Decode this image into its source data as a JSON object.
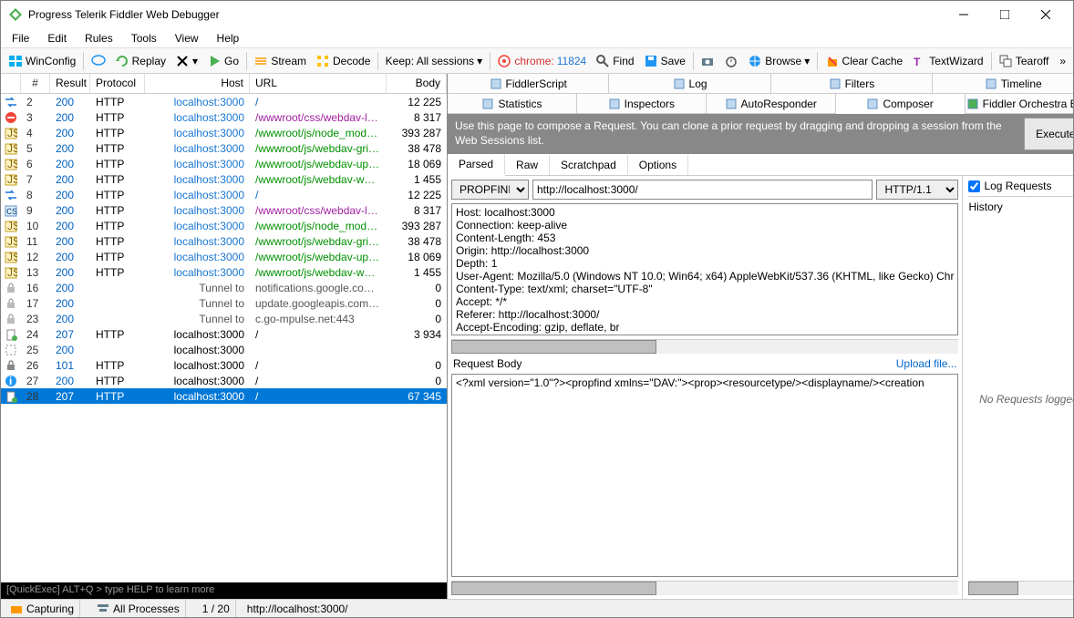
{
  "title": "Progress Telerik Fiddler Web Debugger",
  "menu": [
    "File",
    "Edit",
    "Rules",
    "Tools",
    "View",
    "Help"
  ],
  "toolbar": {
    "winconfig": "WinConfig",
    "replay": "Replay",
    "go": "Go",
    "stream": "Stream",
    "decode": "Decode",
    "keep": "Keep: All sessions",
    "chrome": "chrome:",
    "chrome_pid": "11824",
    "find": "Find",
    "save": "Save",
    "browse": "Browse",
    "clearcache": "Clear Cache",
    "textwizard": "TextWizard",
    "tearoff": "Tearoff"
  },
  "grid": {
    "headers": [
      "#",
      "Result",
      "Protocol",
      "Host",
      "URL",
      "Body"
    ],
    "rows": [
      {
        "ico": "arrows",
        "n": "2",
        "res": "200",
        "proto": "HTTP",
        "host": "localhost:3000",
        "hostc": "host-local",
        "url": "/",
        "urlc": "url-blue",
        "body": "12 225"
      },
      {
        "ico": "stop",
        "n": "3",
        "res": "200",
        "proto": "HTTP",
        "host": "localhost:3000",
        "hostc": "host-local",
        "url": "/wwwroot/css/webdav-la...",
        "urlc": "url-purple",
        "body": "8 317"
      },
      {
        "ico": "js",
        "n": "4",
        "res": "200",
        "proto": "HTTP",
        "host": "localhost:3000",
        "hostc": "host-local",
        "url": "/wwwroot/js/node_modul...",
        "urlc": "url-green",
        "body": "393 287"
      },
      {
        "ico": "js",
        "n": "5",
        "res": "200",
        "proto": "HTTP",
        "host": "localhost:3000",
        "hostc": "host-local",
        "url": "/wwwroot/js/webdav-grid...",
        "urlc": "url-green",
        "body": "38 478"
      },
      {
        "ico": "js",
        "n": "6",
        "res": "200",
        "proto": "HTTP",
        "host": "localhost:3000",
        "hostc": "host-local",
        "url": "/wwwroot/js/webdav-uplo...",
        "urlc": "url-green",
        "body": "18 069"
      },
      {
        "ico": "js",
        "n": "7",
        "res": "200",
        "proto": "HTTP",
        "host": "localhost:3000",
        "hostc": "host-local",
        "url": "/wwwroot/js/webdav-web...",
        "urlc": "url-green",
        "body": "1 455"
      },
      {
        "ico": "arrows",
        "n": "8",
        "res": "200",
        "proto": "HTTP",
        "host": "localhost:3000",
        "hostc": "host-local",
        "url": "/",
        "urlc": "url-blue",
        "body": "12 225"
      },
      {
        "ico": "css",
        "n": "9",
        "res": "200",
        "proto": "HTTP",
        "host": "localhost:3000",
        "hostc": "host-local",
        "url": "/wwwroot/css/webdav-la...",
        "urlc": "url-purple",
        "body": "8 317"
      },
      {
        "ico": "js",
        "n": "10",
        "res": "200",
        "proto": "HTTP",
        "host": "localhost:3000",
        "hostc": "host-local",
        "url": "/wwwroot/js/node_modul...",
        "urlc": "url-green",
        "body": "393 287"
      },
      {
        "ico": "js",
        "n": "11",
        "res": "200",
        "proto": "HTTP",
        "host": "localhost:3000",
        "hostc": "host-local",
        "url": "/wwwroot/js/webdav-grid...",
        "urlc": "url-green",
        "body": "38 478"
      },
      {
        "ico": "js",
        "n": "12",
        "res": "200",
        "proto": "HTTP",
        "host": "localhost:3000",
        "hostc": "host-local",
        "url": "/wwwroot/js/webdav-uplo...",
        "urlc": "url-green",
        "body": "18 069"
      },
      {
        "ico": "js",
        "n": "13",
        "res": "200",
        "proto": "HTTP",
        "host": "localhost:3000",
        "hostc": "host-local",
        "url": "/wwwroot/js/webdav-web...",
        "urlc": "url-green",
        "body": "1 455"
      },
      {
        "ico": "lock",
        "n": "16",
        "res": "200",
        "proto": "",
        "host": "Tunnel to",
        "hostc": "host-tunnel",
        "url": "notifications.google.com:...",
        "urlc": "url-gray",
        "body": "0"
      },
      {
        "ico": "lock",
        "n": "17",
        "res": "200",
        "proto": "",
        "host": "Tunnel to",
        "hostc": "host-tunnel",
        "url": "update.googleapis.com:443",
        "urlc": "url-gray",
        "body": "0"
      },
      {
        "ico": "lock",
        "n": "23",
        "res": "200",
        "proto": "",
        "host": "Tunnel to",
        "hostc": "host-tunnel",
        "url": "c.go-mpulse.net:443",
        "urlc": "url-gray",
        "body": "0"
      },
      {
        "ico": "doc",
        "n": "24",
        "res": "207",
        "proto": "HTTP",
        "host": "localhost:3000",
        "hostc": "",
        "url": "/",
        "urlc": "",
        "body": "3 934"
      },
      {
        "ico": "nc",
        "n": "25",
        "res": "200",
        "proto": "",
        "host": "localhost:3000",
        "hostc": "",
        "url": "",
        "urlc": "",
        "body": ""
      },
      {
        "ico": "lock2",
        "n": "26",
        "res": "101",
        "proto": "HTTP",
        "host": "localhost:3000",
        "hostc": "",
        "url": "/",
        "urlc": "",
        "body": "0"
      },
      {
        "ico": "info",
        "n": "27",
        "res": "200",
        "proto": "HTTP",
        "host": "localhost:3000",
        "hostc": "",
        "url": "/",
        "urlc": "",
        "body": "0"
      },
      {
        "ico": "doc",
        "n": "28",
        "res": "207",
        "proto": "HTTP",
        "host": "localhost:3000",
        "hostc": "",
        "url": "/",
        "urlc": "",
        "body": "67 345",
        "sel": true
      }
    ]
  },
  "quickexec": "[QuickExec] ALT+Q > type HELP to learn more",
  "status": {
    "capturing": "Capturing",
    "allproc": "All Processes",
    "count": "1 / 20",
    "url": "http://localhost:3000/"
  },
  "rtabs_top": [
    {
      "icon": "script",
      "label": "FiddlerScript"
    },
    {
      "icon": "log",
      "label": "Log"
    },
    {
      "icon": "filter",
      "label": "Filters"
    },
    {
      "icon": "timeline",
      "label": "Timeline"
    }
  ],
  "rtabs_bot": [
    {
      "icon": "stats",
      "label": "Statistics"
    },
    {
      "icon": "inspect",
      "label": "Inspectors"
    },
    {
      "icon": "auto",
      "label": "AutoResponder"
    },
    {
      "icon": "composer",
      "label": "Composer",
      "active": true
    },
    {
      "icon": "fo",
      "label": "Fiddler Orchestra Beta"
    }
  ],
  "composer": {
    "hint": "Use this page to compose a Request. You can clone a prior request by dragging and dropping a session from the Web Sessions list.",
    "execute": "Execute",
    "subtabs": [
      "Parsed",
      "Raw",
      "Scratchpad",
      "Options"
    ],
    "method": "PROPFIND",
    "url": "http://localhost:3000/",
    "httpver": "HTTP/1.1",
    "headers": "Host: localhost:3000\nConnection: keep-alive\nContent-Length: 453\nOrigin: http://localhost:3000\nDepth: 1\nUser-Agent: Mozilla/5.0 (Windows NT 10.0; Win64; x64) AppleWebKit/537.36 (KHTML, like Gecko) Chr\nContent-Type: text/xml; charset=\"UTF-8\"\nAccept: */*\nReferer: http://localhost:3000/\nAccept-Encoding: gzip, deflate, br",
    "bodylabel": "Request Body",
    "upload": "Upload file...",
    "body": "<?xml version=\"1.0\"?><propfind xmlns=\"DAV:\"><prop><resourcetype/><displayname/><creation",
    "logrequests": "Log Requests",
    "history": "History",
    "norequests": "No Requests logged"
  }
}
